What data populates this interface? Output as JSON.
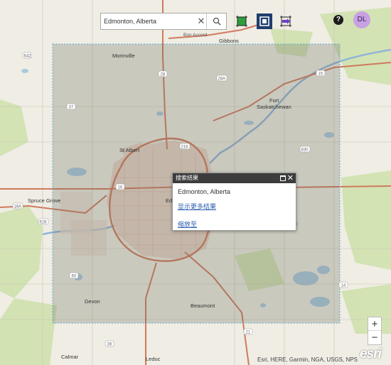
{
  "search": {
    "value": "Edmonton, Alberta",
    "clear_glyph": "✕"
  },
  "toolbar": {
    "tools": [
      {
        "name": "select-tool-icon",
        "color": "#2e9e3c"
      },
      {
        "name": "extent-select-tool-icon",
        "color": "#1f3e6b"
      },
      {
        "name": "move-tool-icon",
        "color": "#6a3ec9"
      }
    ]
  },
  "header": {
    "help_label": "?",
    "user_initials": "DL"
  },
  "popup": {
    "header": "搜索结果",
    "title": "Edmonton, Alberta",
    "more_results": "显示更多结果",
    "zoom_to": "缩放至"
  },
  "map": {
    "places": [
      "Bon Accord",
      "Gibbons",
      "Morinville",
      "Fort",
      "Saskatchewan",
      "St Albert",
      "Spruce Grove",
      "Edmonton",
      "Devon",
      "Beaumont",
      "Calmar",
      "Leduc"
    ],
    "highway_shields": [
      "642",
      "37",
      "28",
      "28A",
      "15",
      "216",
      "830",
      "16",
      "16A",
      "628",
      "60",
      "14",
      "21",
      "39"
    ],
    "colors": {
      "base": "#efede4",
      "green": "#c9dfa9",
      "water": "#a7c8e0",
      "urban": "#e8d6cc",
      "road": "#d0775b",
      "selection": "#66b3d9"
    }
  },
  "zoom": {
    "in": "+",
    "out": "−"
  },
  "attribution": "Esri, HERE, Garmin, NGA, USGS, NPS",
  "logo": "esri"
}
